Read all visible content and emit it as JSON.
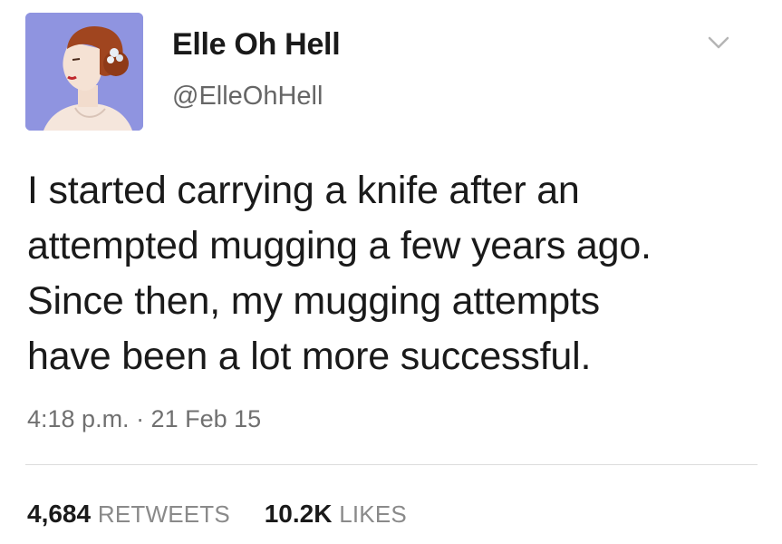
{
  "user": {
    "display_name": "Elle Oh Hell",
    "handle": "@ElleOhHell",
    "avatar_icon": "woman-profile-avatar"
  },
  "tweet": {
    "lines": [
      "I started carrying a knife after an",
      "attempted mugging a few years ago.",
      "Since then, my mugging attempts",
      "have been a lot more successful."
    ],
    "timestamp": "4:18 p.m. · 21 Feb 15"
  },
  "stats": {
    "retweets_count": "4,684",
    "retweets_label": "RETWEETS",
    "likes_count": "10.2K",
    "likes_label": "LIKES"
  },
  "colors": {
    "avatar_bg": "#8f94e0",
    "text": "#1a1a1a",
    "muted": "#666666"
  }
}
